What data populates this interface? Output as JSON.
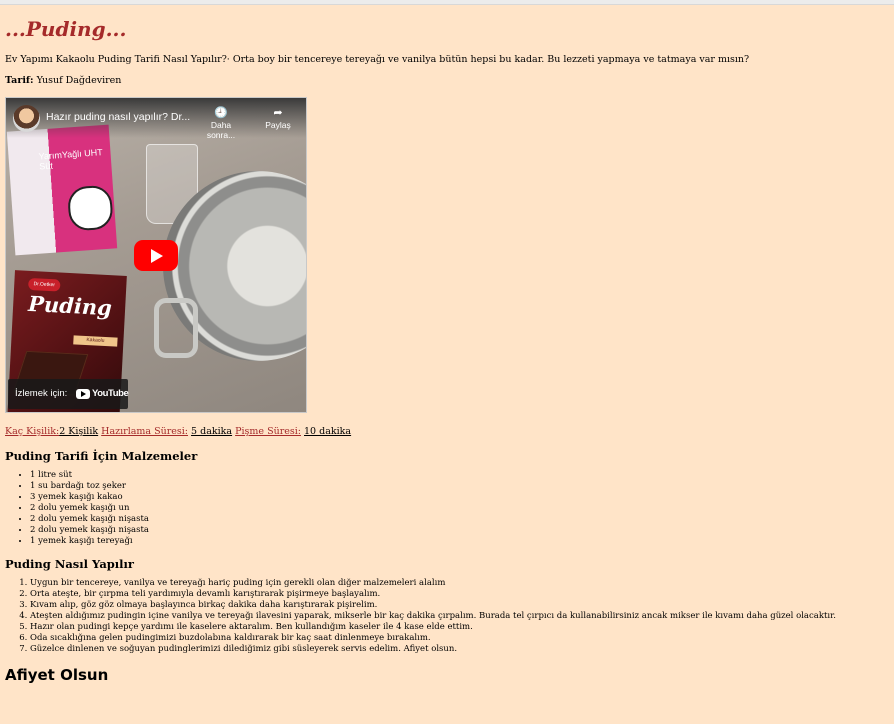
{
  "title": "...Puding...",
  "intro": "Ev Yapımı Kakaolu Puding Tarifi Nasıl Yapılır?· Orta boy bir tencereye tereyağı ve vanilya bütün hepsi bu kadar. Bu lezzeti yapmaya ve tatmaya var mısın?",
  "author": {
    "label": "Tarif:",
    "name": "Yusuf Dağdeviren"
  },
  "video": {
    "title": "Hazır puding nasıl yapılır? Dr...",
    "watch_later": "Daha sonra...",
    "share": "Paylaş",
    "watch_on": "İzlemek için:",
    "youtube": "YouTube",
    "milk_text": "YarımYağlı UHT Süt",
    "pack_brand": "Dr.Oetker",
    "pack_name": "Puding",
    "pack_flavor": "Kakaolu"
  },
  "meta": {
    "servings_label": "Kaç Kişilik:",
    "servings_value": "2 Kişilik",
    "prep_label": "Hazırlama Süresi:",
    "prep_value": "5 dakika",
    "cook_label": "Pişme Süresi:",
    "cook_value": "10 dakika"
  },
  "ingredients_heading": "Puding Tarifi İçin Malzemeler",
  "ingredients": [
    "1 litre süt",
    "1 su bardağı toz şeker",
    "3 yemek kaşığı kakao",
    "2 dolu yemek kaşığı un",
    "2 dolu yemek kaşığı nişasta",
    "2 dolu yemek kaşığı nişasta",
    "1 yemek kaşığı tereyağı"
  ],
  "steps_heading": "Puding Nasıl Yapılır",
  "steps": [
    "Uygun bir tencereye, vanilya ve tereyağı hariç puding için gerekli olan diğer malzemeleri alalım",
    "Orta ateşte, bir çırpma teli yardımıyla devamlı karıştırarak pişirmeye başlayalım.",
    "Kıvam alıp, göz göz olmaya başlayınca birkaç dakika daha karıştırarak pişirelim.",
    "Ateşten aldığımız pudingin içine vanilya ve tereyağı ilavesini yaparak, mikserle bir kaç dakika çırpalım. Burada tel çırpıcı da kullanabilirsiniz ancak mikser ile kıvamı daha güzel olacaktır.",
    "Hazır olan pudingi kepçe yardımı ile kaselere aktaralım. Ben kullandığım kaseler ile 4 kase elde ettim.",
    "Oda sıcaklığına gelen pudingimizi buzdolabına kaldırarak bir kaç saat dinlenmeye bırakalım.",
    "Güzelce dinlenen ve soğuyan pudinglerimizi dilediğimiz gibi süsleyerek servis edelim. Afiyet olsun."
  ],
  "closing": "Afiyet Olsun",
  "colors": {
    "background": "#ffe4c8",
    "title": "#a52a2a",
    "link": "#a52a2a",
    "play": "#ff0000"
  }
}
